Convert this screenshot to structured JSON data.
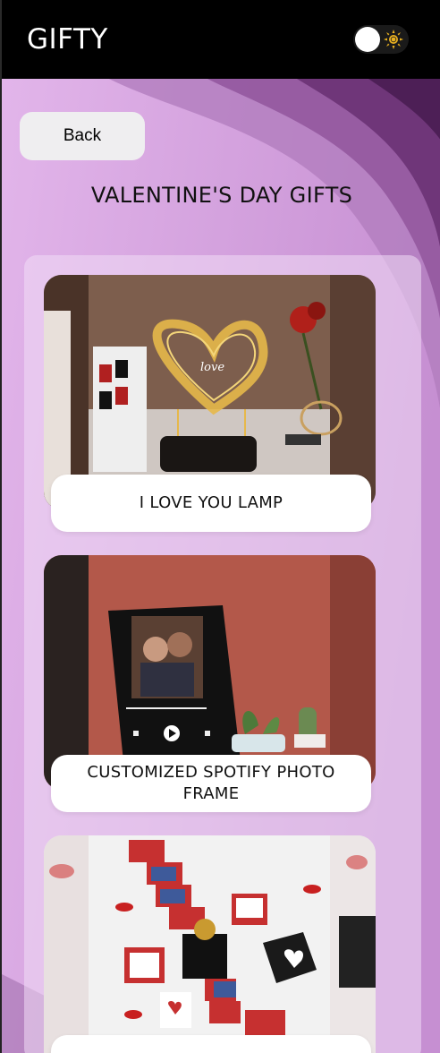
{
  "navbar": {
    "brand": "GIFTY",
    "theme_toggle": {
      "state": "light",
      "icon": "sun-icon"
    }
  },
  "back_button": {
    "label": "Back"
  },
  "page_title": "VALENTINE'S DAY GIFTS",
  "products": [
    {
      "name": "I LOVE YOU LAMP",
      "image": "heart-lamp-image"
    },
    {
      "name": "CUSTOMIZED SPOTIFY PHOTO FRAME",
      "image": "spotify-frame-image"
    },
    {
      "name": "",
      "image": "explosion-box-image"
    }
  ],
  "colors": {
    "navbar": "#000000",
    "bg_light": "#dca9e4",
    "bg_dark": "#5a2560",
    "button": "#efeef0",
    "sun": "#e8b020"
  }
}
